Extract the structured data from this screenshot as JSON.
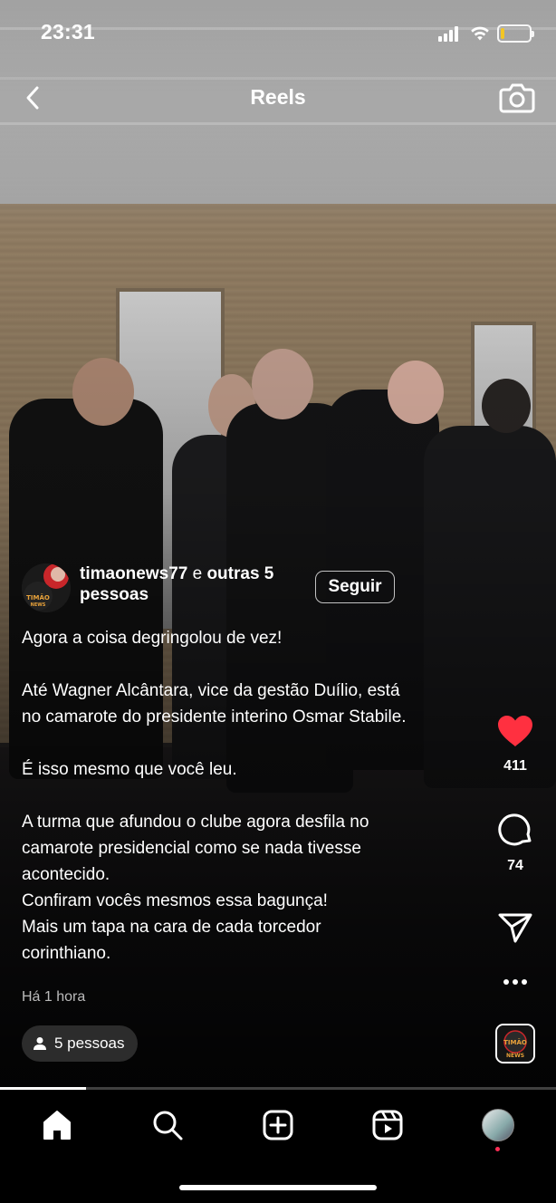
{
  "status_bar": {
    "time": "23:31",
    "battery_color": "#f3c623"
  },
  "header": {
    "title": "Reels",
    "back_icon": "chevron-left-icon",
    "camera_icon": "camera-icon"
  },
  "reel": {
    "author": {
      "username": "timaonews77",
      "connector": " e ",
      "others": "outras 5 pessoas",
      "avatar_text": "TIMÃO NEWS",
      "follow_label": "Seguir"
    },
    "caption_lines": [
      "Agora a coisa degringolou de vez!",
      "",
      "Até Wagner Alcântara, vice da gestão Duílio, está",
      "no camarote do presidente interino Osmar Stabile.",
      "",
      "É isso mesmo que você leu.",
      "",
      "A turma que afundou o clube agora desfila no",
      "camarote presidencial como se nada tivesse",
      "acontecido.",
      "Confiram vocês mesmos essa bagunça!",
      "Mais um tapa na cara de cada torcedor",
      "corinthiano."
    ],
    "time_ago": "Há 1 hora",
    "people_chip": "5 pessoas",
    "likes": "411",
    "comments": "74",
    "like_color": "#ff3040",
    "audio_tile_text": "TIMÃO NEWS",
    "progress_fraction": 0.155
  },
  "nav": {
    "items": [
      "home-icon",
      "search-icon",
      "create-icon",
      "reels-icon",
      "profile-avatar"
    ],
    "notification_dot_color": "#ff2d55"
  }
}
